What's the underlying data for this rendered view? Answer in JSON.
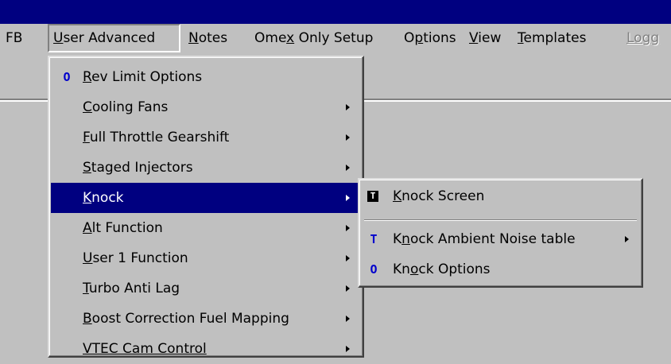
{
  "menubar": {
    "items": [
      {
        "label": "FB"
      },
      {
        "pre": "",
        "u": "U",
        "post": "ser Advanced"
      },
      {
        "pre": "",
        "u": "N",
        "post": "otes"
      },
      {
        "pre": "Ome",
        "u": "x",
        "post": " Only Setup"
      },
      {
        "pre": "O",
        "u": "p",
        "post": "tions"
      },
      {
        "pre": "",
        "u": "V",
        "post": "iew"
      },
      {
        "pre": "",
        "u": "T",
        "post": "emplates"
      },
      {
        "label": "Logg"
      }
    ]
  },
  "menu": {
    "items": [
      {
        "mark": "O",
        "pre": "",
        "u": "R",
        "post": "ev Limit Options"
      },
      {
        "pre": "",
        "u": "C",
        "post": "ooling Fans"
      },
      {
        "pre": "",
        "u": "F",
        "post": "ull Throttle Gearshift"
      },
      {
        "pre": "",
        "u": "S",
        "post": "taged Injectors"
      },
      {
        "pre": "",
        "u": "K",
        "post": "nock"
      },
      {
        "pre": "",
        "u": "A",
        "post": "lt Function"
      },
      {
        "pre": "",
        "u": "U",
        "post": "ser 1 Function"
      },
      {
        "pre": "",
        "u": "T",
        "post": "urbo Anti Lag"
      },
      {
        "pre": "",
        "u": "B",
        "post": "oost Correction Fuel Mapping"
      },
      {
        "label": "VTEC Cam Control"
      }
    ]
  },
  "submenu": {
    "items": [
      {
        "mark": "T",
        "pre": "",
        "u": "K",
        "post": "nock Screen"
      },
      {
        "mark": "T",
        "pre": "K",
        "u": "n",
        "post": "ock Ambient Noise table"
      },
      {
        "mark": "O",
        "pre": "Kn",
        "u": "o",
        "post": "ck Options"
      }
    ]
  },
  "colors": {
    "title_bar": "#000080",
    "highlight": "#000080",
    "face": "#c0c0c0",
    "mark_blue": "#0000cc"
  }
}
